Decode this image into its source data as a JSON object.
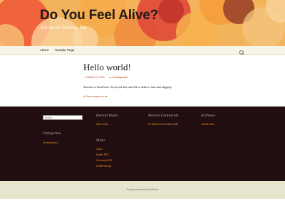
{
  "site": {
    "title": "Do You Feel Alive?",
    "description": "No more boring life"
  },
  "nav": {
    "items": [
      {
        "label": "About"
      },
      {
        "label": "Sample Page"
      }
    ],
    "search_icon": "search-icon"
  },
  "post": {
    "title": "Hello world!",
    "date": "October 12, 2011",
    "category": "Uncategorized",
    "body": "Welcome to WordPress. This is your first post. Edit or delete it, then start blogging!",
    "comment_link": "One comment so far"
  },
  "widgets": {
    "search_placeholder": "Search …",
    "recent_posts": {
      "title": "Recent Posts",
      "items": [
        "Hello world!"
      ]
    },
    "recent_comments": {
      "title": "Recent Comments",
      "author": "Mr WordPress",
      "connector": "on",
      "post": "Hello world!"
    },
    "archives": {
      "title": "Archives",
      "items": [
        "October 2011"
      ]
    },
    "categories": {
      "title": "Categories",
      "items": [
        "Uncategorized"
      ]
    },
    "meta": {
      "title": "Meta",
      "items": [
        "Log in",
        "Entries RSS",
        "Comments RSS",
        "WordPress.org"
      ]
    }
  },
  "footer": {
    "credit": "Proudly powered by WordPress"
  },
  "colors": {
    "accent": "#bc360a",
    "widget_link": "#ea9629",
    "footer_widgets_bg": "#220e10",
    "header_bg": "#f3b35b"
  }
}
